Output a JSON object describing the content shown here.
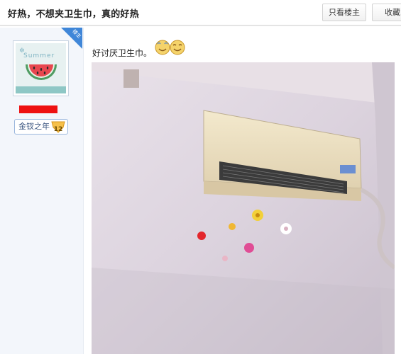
{
  "thread": {
    "title": "好热，不想夹卫生巾，真的好热",
    "buttons": {
      "only_op": "只看楼主",
      "favorite": "收藏"
    }
  },
  "author": {
    "corner_badge": "楼主",
    "avatar_text": "Summer",
    "level_label": "金钗之年",
    "level_number": "12"
  },
  "post": {
    "text": "好讨厌卫生巾。",
    "emoticons": [
      "smiley-emoji",
      "smiley-emoji"
    ]
  },
  "colors": {
    "accent_blue": "#3f86d8",
    "username_redaction": "#ee1111",
    "sidebar_bg": "#f3f6fb"
  }
}
